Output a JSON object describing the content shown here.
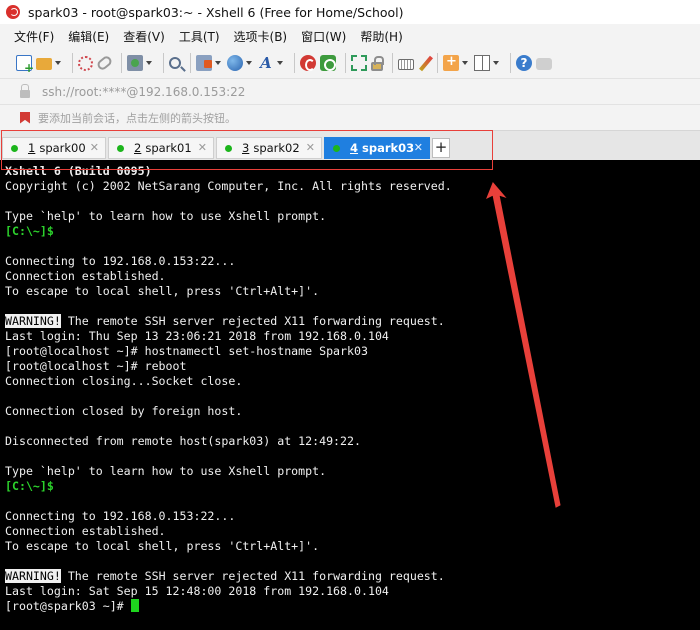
{
  "window": {
    "title": "spark03 - root@spark03:~ - Xshell 6 (Free for Home/School)"
  },
  "menu": {
    "items": [
      "文件(F)",
      "编辑(E)",
      "查看(V)",
      "工具(T)",
      "选项卡(B)",
      "窗口(W)",
      "帮助(H)"
    ]
  },
  "toolbar": {
    "icons": [
      "new-session-icon",
      "open-folder-icon",
      "reconnect-icon",
      "disconnect-icon",
      "properties-icon",
      "find-icon",
      "transfer-icon",
      "globe-icon",
      "font-icon",
      "xftp-icon",
      "xmanager-icon",
      "fullscreen-icon",
      "lock-icon",
      "keyboard-icon",
      "highlight-pen-icon",
      "new-tab-icon",
      "layout-icon",
      "help-icon",
      "chat-icon"
    ]
  },
  "address": {
    "value": "ssh://root:****@192.168.0.153:22"
  },
  "hint": {
    "text": "要添加当前会话，点击左侧的箭头按钮。"
  },
  "tabs": [
    {
      "number": "1",
      "name": "spark00",
      "active": false
    },
    {
      "number": "2",
      "name": "spark01",
      "active": false
    },
    {
      "number": "3",
      "name": "spark02",
      "active": false
    },
    {
      "number": "4",
      "name": "spark03",
      "active": true
    }
  ],
  "tab_add": {
    "label": "+"
  },
  "terminal": {
    "lines": [
      {
        "text": "Xshell 6 (Build 0095)",
        "style": "bold"
      },
      {
        "text": "Copyright (c) 2002 NetSarang Computer, Inc. All rights reserved."
      },
      {
        "text": ""
      },
      {
        "text": "Type `help' to learn how to use Xshell prompt."
      },
      {
        "text": "[C:\\~]$",
        "style": "green"
      },
      {
        "text": ""
      },
      {
        "text": "Connecting to 192.168.0.153:22..."
      },
      {
        "text": "Connection established."
      },
      {
        "text": "To escape to local shell, press 'Ctrl+Alt+]'."
      },
      {
        "text": ""
      },
      {
        "prefix": "WARNING!",
        "text": " The remote SSH server rejected X11 forwarding request."
      },
      {
        "text": "Last login: Thu Sep 13 23:06:21 2018 from 192.168.0.104"
      },
      {
        "text": "[root@localhost ~]# hostnamectl set-hostname Spark03"
      },
      {
        "text": "[root@localhost ~]# reboot"
      },
      {
        "text": "Connection closing...Socket close."
      },
      {
        "text": ""
      },
      {
        "text": "Connection closed by foreign host."
      },
      {
        "text": ""
      },
      {
        "text": "Disconnected from remote host(spark03) at 12:49:22."
      },
      {
        "text": ""
      },
      {
        "text": "Type `help' to learn how to use Xshell prompt."
      },
      {
        "text": "[C:\\~]$",
        "style": "green"
      },
      {
        "text": ""
      },
      {
        "text": "Connecting to 192.168.0.153:22..."
      },
      {
        "text": "Connection established."
      },
      {
        "text": "To escape to local shell, press 'Ctrl+Alt+]'."
      },
      {
        "text": ""
      },
      {
        "prefix": "WARNING!",
        "text": " The remote SSH server rejected X11 forwarding request."
      },
      {
        "text": "Last login: Sat Sep 15 12:48:00 2018 from 192.168.0.104"
      },
      {
        "text": "[root@spark03 ~]# ",
        "cursor": true
      }
    ]
  },
  "colors": {
    "active_tab": "#1f7fe0",
    "status_dot": "#1cb51c",
    "prompt_green": "#2cd12c",
    "annotation_red": "#e8403a",
    "terminal_bg": "#000000"
  }
}
